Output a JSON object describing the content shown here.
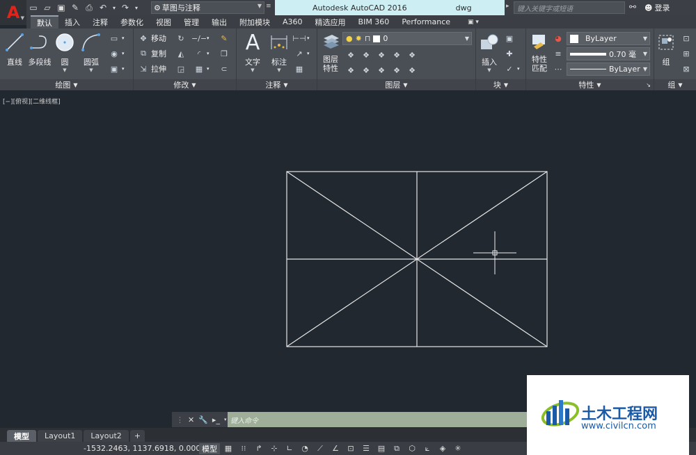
{
  "title_bar": {
    "app_letter": "A",
    "workspace": "草图与注释",
    "doc_title_app": "Autodesk AutoCAD 2016",
    "doc_title_file": "dwg",
    "search_placeholder": "键入关键字或短语",
    "login": "登录"
  },
  "ribbon_tabs": [
    "默认",
    "插入",
    "注释",
    "参数化",
    "视图",
    "管理",
    "输出",
    "附加模块",
    "A360",
    "精选应用",
    "BIM 360",
    "Performance"
  ],
  "ribbon_tab_extra": "▣ ▾",
  "panels": {
    "draw": {
      "title": "绘图",
      "tools": [
        "直线",
        "多段线",
        "圆",
        "圆弧"
      ]
    },
    "modify": {
      "title": "修改",
      "tools": [
        "移动",
        "复制",
        "拉伸"
      ]
    },
    "annotation": {
      "title": "注释",
      "tools": [
        "文字",
        "标注"
      ]
    },
    "layers": {
      "title": "图层",
      "tool": "图层特性",
      "tool_line1": "图层",
      "tool_line2": "特性",
      "current_layer": "0"
    },
    "block": {
      "title": "块",
      "tool": "插入"
    },
    "properties": {
      "title": "特性",
      "tool_line1": "特性",
      "tool_line2": "匹配",
      "color": "ByLayer",
      "lineweight": "0.70 毫",
      "linetype": "ByLayer"
    },
    "group": {
      "title": "组",
      "tool": "组"
    }
  },
  "viewport": {
    "label": "[−][俯视][二维线框]"
  },
  "command_line": {
    "placeholder": "键入命令"
  },
  "layout_tabs": [
    "模型",
    "Layout1",
    "Layout2",
    "+"
  ],
  "status_bar": {
    "coordinates": "-1532.2463, 1137.6918, 0.0000",
    "model": "模型"
  },
  "watermark": {
    "name": "土木工程网",
    "url": "www.civilcn.com"
  },
  "colors": {
    "accent": "#cdeff4",
    "app_logo": "#e0241b",
    "command_line_bg": "#9eae99",
    "drawing_lines": "#e6e6e6",
    "viewport_bg": "#212830",
    "watermark_blue": "#1a5aa7"
  }
}
